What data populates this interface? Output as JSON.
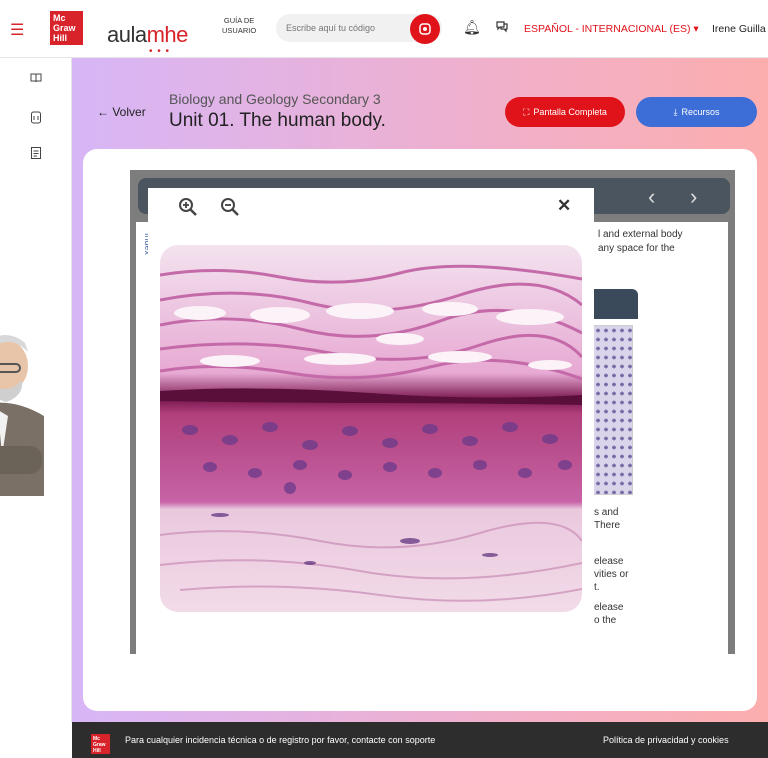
{
  "header": {
    "logo_text": "Mc Graw Hill",
    "app_logo_prefix": "aula",
    "app_logo_suffix": "mhe",
    "guide_line1": "GUÍA DE",
    "guide_line2": "USUARIO",
    "search_placeholder": "Escribe aquí tu código",
    "language": "ESPAÑOL - INTERNACIONAL (ES)",
    "user_name": "Irene Guilla"
  },
  "page": {
    "back_label": "Volver",
    "course_title": "Biology and Geology Secondary 3",
    "unit_title": "Unit 01. The human body.",
    "fullscreen_label": "Pantalla Completa",
    "resources_label": "Recursos"
  },
  "book": {
    "index_label": "Index",
    "text_top1": "l and external body",
    "text_top2": "any space for the",
    "text_mid1": "s and",
    "text_mid2": "There",
    "text_mid3": "elease",
    "text_mid4": "vities or",
    "text_mid5": "t.",
    "text_mid6": "elease",
    "text_mid7": "o the"
  },
  "footer": {
    "logo_text": "Mc Graw Hill",
    "message": "Para cualquier incidencia técnica o de registro por favor, contacte con",
    "support_link": "soporte",
    "policy_link": "Política de privacidad y cookies"
  }
}
